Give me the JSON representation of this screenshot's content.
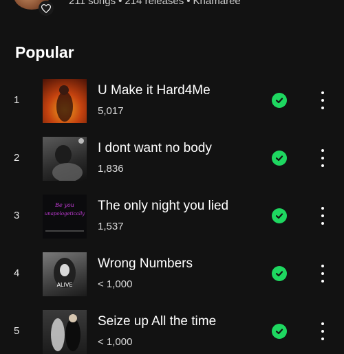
{
  "artist": {
    "meta": {
      "songs": "211 songs",
      "releases": "214 releases",
      "name": "Khamaree",
      "separator": "•"
    }
  },
  "section": {
    "title": "Popular"
  },
  "tracks": [
    {
      "rank": "1",
      "title": "U Make it Hard4Me",
      "plays": "5,017",
      "saved": true
    },
    {
      "rank": "2",
      "title": "I dont want no body",
      "plays": "1,836",
      "saved": true
    },
    {
      "rank": "3",
      "title": "The only night you lied",
      "plays": "1,537",
      "saved": true,
      "cover_text": "Be you unapologetically"
    },
    {
      "rank": "4",
      "title": "Wrong Numbers",
      "plays": "< 1,000",
      "saved": true,
      "cover_text": "ALIVE"
    },
    {
      "rank": "5",
      "title": "Seize up All the time",
      "plays": "< 1,000",
      "saved": true
    }
  ],
  "colors": {
    "accent": "#1ed760",
    "background": "#121212"
  },
  "icons": {
    "saved": "check-icon",
    "more": "more-vertical-icon",
    "like": "heart-icon"
  }
}
